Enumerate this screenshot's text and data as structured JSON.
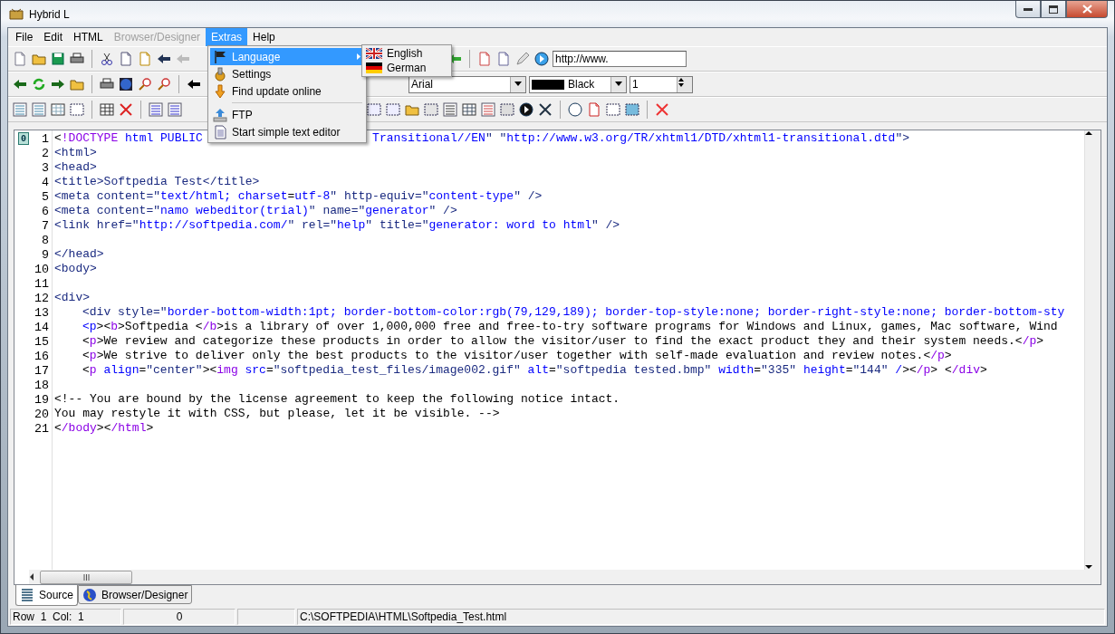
{
  "window": {
    "title": "Hybrid L"
  },
  "menubar": [
    {
      "label": "File",
      "disabled": false,
      "selected": false
    },
    {
      "label": "Edit",
      "disabled": false,
      "selected": false
    },
    {
      "label": "HTML",
      "disabled": false,
      "selected": false
    },
    {
      "label": "Browser/Designer",
      "disabled": true,
      "selected": false
    },
    {
      "label": "Extras",
      "disabled": false,
      "selected": true
    },
    {
      "label": "Help",
      "disabled": false,
      "selected": false
    }
  ],
  "extras_menu": [
    {
      "kind": "submenu",
      "label": "Language",
      "selected": true
    },
    {
      "kind": "item",
      "label": "Settings",
      "selected": false
    },
    {
      "kind": "item",
      "label": "Find update online",
      "selected": false
    },
    {
      "kind": "separator"
    },
    {
      "kind": "item",
      "label": "FTP",
      "selected": false
    },
    {
      "kind": "item",
      "label": "Start simple text editor",
      "selected": false
    }
  ],
  "language_menu": [
    {
      "label": "English"
    },
    {
      "label": "German"
    }
  ],
  "url_field": {
    "value": "http://www."
  },
  "font_combo": {
    "value": "Arial"
  },
  "color_combo": {
    "value": "Black",
    "color": "#000000"
  },
  "size_spinner": {
    "value": "1"
  },
  "editor": {
    "bookmark": "0",
    "lines": [
      {
        "n": "1",
        "indent": false,
        "parts": [
          "<!DOCTYPE html PUBLIC",
          "Transitional//EN\" \"http://www.w3.org/TR/xhtml1/DTD/xhtml1-transitional.dtd\">"
        ]
      },
      {
        "n": "2",
        "indent": false,
        "parts": [
          "<html>"
        ]
      },
      {
        "n": "3",
        "indent": false,
        "parts": [
          "<head>"
        ]
      },
      {
        "n": "4",
        "indent": false,
        "parts": [
          "<title>Softpedia Test</title>"
        ]
      },
      {
        "n": "5",
        "indent": false,
        "parts": [
          "<meta content=\"text/html; charset=utf-8\" http-equiv=\"content-type\" />"
        ]
      },
      {
        "n": "6",
        "indent": false,
        "parts": [
          "<meta content=\"namo webeditor(trial)\" name=\"generator\" />"
        ]
      },
      {
        "n": "7",
        "indent": false,
        "parts": [
          "<link href=\"http://softpedia.com/\" rel=\"help\" title=\"generator: word to html\" />"
        ]
      },
      {
        "n": "8"
      },
      {
        "n": "9",
        "indent": false,
        "parts": [
          "</head>"
        ]
      },
      {
        "n": "10",
        "indent": false,
        "parts": [
          "<body>"
        ]
      },
      {
        "n": "11"
      },
      {
        "n": "12",
        "indent": false,
        "parts": [
          "<div>"
        ]
      },
      {
        "n": "13",
        "indent": true,
        "parts": [
          "<div style=\"border-bottom-width:1pt; border-bottom-color:rgb(79,129,189); border-top-style:none; border-right-style:none; border-bottom-sty"
        ]
      },
      {
        "n": "14",
        "indent": true,
        "parts": [
          "<p><b>Softpedia </b>is a library of over 1,000,000 free and free-to-try software programs for Windows and Linux, games, Mac software, Wind"
        ]
      },
      {
        "n": "15",
        "indent": true,
        "parts": [
          "<p>We review and categorize these products in order to allow the visitor/user to find the exact product they and their system needs.</p>"
        ]
      },
      {
        "n": "16",
        "indent": true,
        "parts": [
          "<p>We strive to deliver only the best products to the visitor/user together with self-made evaluation and review notes.</p>"
        ]
      },
      {
        "n": "17",
        "indent": true,
        "parts": [
          "<p align=\"center\"><img src=\"softpedia_test_files/image002.gif\" alt=\"softpedia tested.bmp\" width=\"335\" height=\"144\" /></p> </div>"
        ]
      },
      {
        "n": "18"
      },
      {
        "n": "19",
        "indent": false,
        "parts": [
          "<!-- You are bound by the license agreement to keep the following notice intact."
        ]
      },
      {
        "n": "20",
        "indent": false,
        "parts": [
          "You may restyle it with CSS, but please, let it be visible. -->"
        ]
      },
      {
        "n": "21",
        "indent": false,
        "parts": [
          "</body></html>"
        ]
      }
    ]
  },
  "view_tabs": [
    {
      "label": "Source",
      "selected": true
    },
    {
      "label": "Browser/Designer",
      "selected": false
    }
  ],
  "status_bar": {
    "position": "Row  1  Col:  1",
    "count": "0",
    "path": "C:\\SOFTPEDIA\\HTML\\Softpedia_Test.html"
  }
}
